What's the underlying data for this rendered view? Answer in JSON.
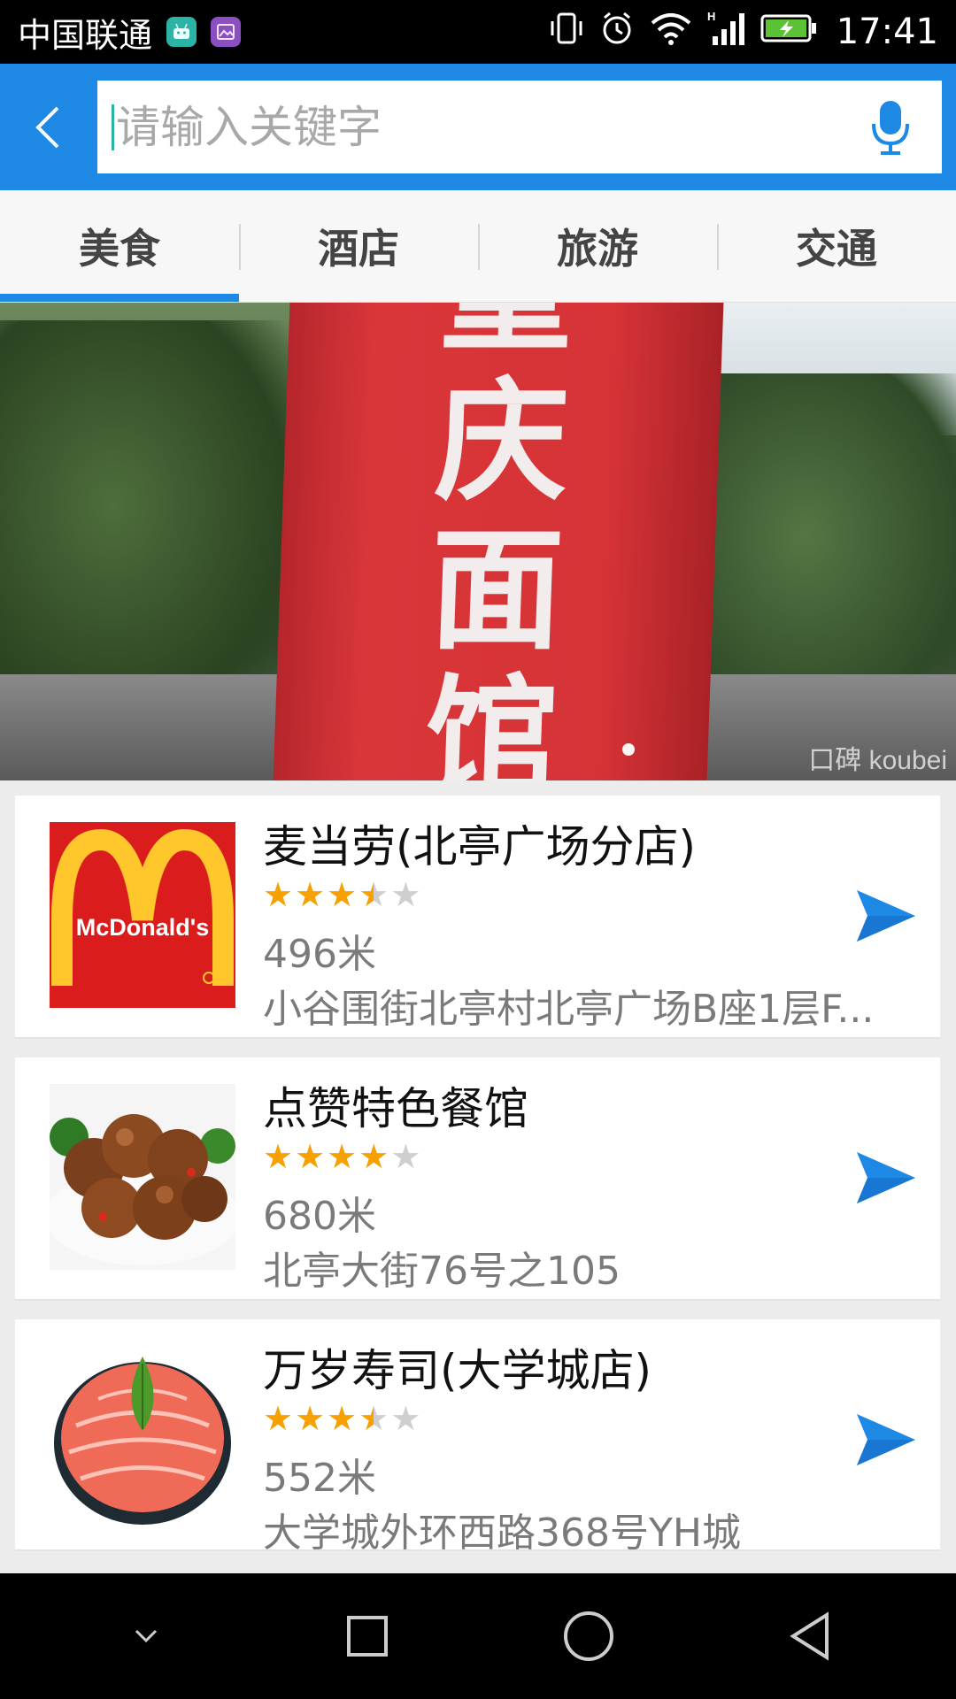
{
  "status_bar": {
    "carrier": "中国联通",
    "time": "17:41",
    "icons": [
      "android-icon",
      "gallery-icon",
      "vibrate-icon",
      "alarm-icon",
      "wifi-icon",
      "signal-icon",
      "battery-charging-icon"
    ]
  },
  "header": {
    "back_icon": "chevron-left-icon",
    "search_placeholder": "请输入关键字",
    "mic_icon": "microphone-icon",
    "accent_color": "#1e88e5"
  },
  "tabs": [
    {
      "label": "美食",
      "active": true
    },
    {
      "label": "酒店",
      "active": false
    },
    {
      "label": "旅游",
      "active": false
    },
    {
      "label": "交通",
      "active": false
    }
  ],
  "banner": {
    "sign_chars": [
      "重",
      "庆",
      "面",
      "馆"
    ],
    "watermark": "口碑 koubei",
    "page_count": 1,
    "current_page": 1
  },
  "restaurants": [
    {
      "name": "麦当劳(北亭广场分店)",
      "rating": 3.5,
      "distance": "496米",
      "address": "小谷围街北亭村北亭广场B座1层F...",
      "thumb": "mcdonalds-logo",
      "thumb_text": "McDonald's",
      "nav_icon": "navigate-arrow-icon"
    },
    {
      "name": "点赞特色餐馆",
      "rating": 4,
      "distance": "680米",
      "address": "北亭大街76号之105",
      "thumb": "braised-pork-photo",
      "nav_icon": "navigate-arrow-icon"
    },
    {
      "name": "万岁寿司(大学城店)",
      "rating": 3.5,
      "distance": "552米",
      "address": "大学城外环西路368号YH城",
      "thumb": "salmon-sushi-photo",
      "nav_icon": "navigate-arrow-icon"
    }
  ],
  "nav_bar": {
    "keys": [
      "hide-keyboard-icon",
      "recents-icon",
      "home-icon",
      "back-icon"
    ]
  }
}
